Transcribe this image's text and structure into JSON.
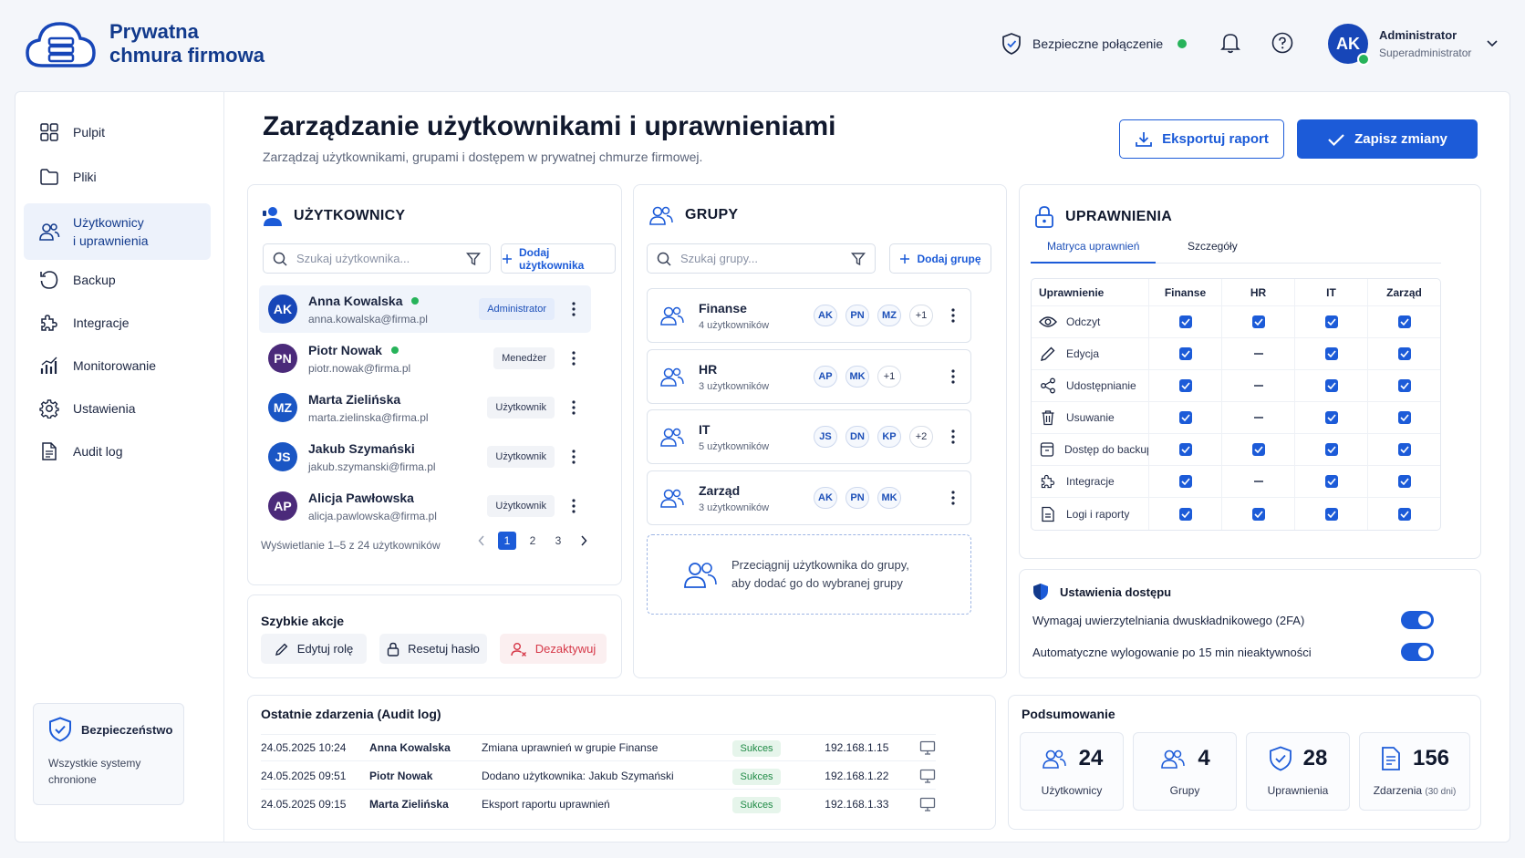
{
  "brand": {
    "line1": "Prywatna",
    "line2": "chmura firmowa"
  },
  "header": {
    "secure_label": "Bezpieczne połączenie",
    "user": {
      "initials": "AK",
      "name": "Administrator",
      "role": "Superadministrator"
    }
  },
  "sidebar": {
    "items": [
      {
        "label": "Pulpit",
        "icon": "grid-icon"
      },
      {
        "label": "Pliki",
        "icon": "folder-icon"
      },
      {
        "label": "Użytkownicy i uprawnienia",
        "line1": "Użytkownicy",
        "line2": "i uprawnienia",
        "icon": "users-icon",
        "active": true
      },
      {
        "label": "Backup",
        "icon": "backup-icon"
      },
      {
        "label": "Integracje",
        "icon": "puzzle-icon"
      },
      {
        "label": "Monitorowanie",
        "icon": "chart-icon"
      },
      {
        "label": "Ustawienia",
        "icon": "gear-icon"
      },
      {
        "label": "Audit log",
        "icon": "document-icon"
      }
    ],
    "security": {
      "title": "Bezpieczeństwo",
      "desc_line1": "Wszystkie systemy",
      "desc_line2": "chronione"
    }
  },
  "page": {
    "title": "Zarządzanie użytkownikami i uprawnieniami",
    "subtitle": "Zarządzaj użytkownikami, grupami i dostępem w prywatnej chmurze firmowej.",
    "export_label": "Eksportuj raport",
    "save_label": "Zapisz zmiany"
  },
  "users": {
    "title": "UŻYTKOWNICY",
    "search_placeholder": "Szukaj użytkownika...",
    "add_label": "Dodaj użytkownika",
    "list": [
      {
        "initials": "AK",
        "name": "Anna Kowalska",
        "email": "anna.kowalska@firma.pl",
        "role": "Administrator",
        "online": true,
        "color": "#1746b8"
      },
      {
        "initials": "PN",
        "name": "Piotr Nowak",
        "email": "piotr.nowak@firma.pl",
        "role": "Menedżer",
        "online": true,
        "color": "#4b2a7a"
      },
      {
        "initials": "MZ",
        "name": "Marta Zielińska",
        "email": "marta.zielinska@firma.pl",
        "role": "Użytkownik",
        "online": false,
        "color": "#1a56c4"
      },
      {
        "initials": "JS",
        "name": "Jakub Szymański",
        "email": "jakub.szymanski@firma.pl",
        "role": "Użytkownik",
        "online": false,
        "color": "#1a56c4"
      },
      {
        "initials": "AP",
        "name": "Alicja Pawłowska",
        "email": "alicja.pawlowska@firma.pl",
        "role": "Użytkownik",
        "online": false,
        "color": "#4b2a7a"
      }
    ],
    "pagination_text": "Wyświetlanie 1–5 z 24 użytkowników",
    "pages": [
      "1",
      "2",
      "3"
    ],
    "current_page": "1"
  },
  "quick_actions": {
    "title": "Szybkie akcje",
    "edit_role": "Edytuj rolę",
    "reset_password": "Resetuj hasło",
    "deactivate": "Dezaktywuj"
  },
  "groups": {
    "title": "GRUPY",
    "search_placeholder": "Szukaj grupy...",
    "add_label": "Dodaj grupę",
    "list": [
      {
        "name": "Finanse",
        "count": "4 użytkowników",
        "members": [
          "AK",
          "PN",
          "MZ"
        ],
        "more": "+1"
      },
      {
        "name": "HR",
        "count": "3 użytkowników",
        "members": [
          "AP",
          "MK"
        ],
        "more": "+1"
      },
      {
        "name": "IT",
        "count": "5 użytkowników",
        "members": [
          "JS",
          "DN",
          "KP"
        ],
        "more": "+2"
      },
      {
        "name": "Zarząd",
        "count": "3 użytkowników",
        "members": [
          "AK",
          "PN",
          "MK"
        ],
        "more": ""
      }
    ],
    "drop_line1": "Przeciągnij użytkownika do grupy,",
    "drop_line2": "aby dodać go do wybranej grupy"
  },
  "permissions": {
    "title": "UPRAWNIENIA",
    "tabs": [
      "Matryca uprawnień",
      "Szczegóły"
    ],
    "columns": [
      "Uprawnienie",
      "Finanse",
      "HR",
      "IT",
      "Zarząd"
    ],
    "rows": [
      {
        "label": "Odczyt",
        "icon": "eye-icon",
        "values": [
          true,
          true,
          true,
          true
        ]
      },
      {
        "label": "Edycja",
        "icon": "pencil-icon",
        "values": [
          true,
          false,
          true,
          true
        ]
      },
      {
        "label": "Udostępnianie",
        "icon": "share-icon",
        "values": [
          true,
          false,
          true,
          true
        ]
      },
      {
        "label": "Usuwanie",
        "icon": "trash-icon",
        "values": [
          true,
          false,
          true,
          true
        ]
      },
      {
        "label": "Dostęp do backupu",
        "icon": "archive-icon",
        "values": [
          true,
          true,
          true,
          true
        ]
      },
      {
        "label": "Integracje",
        "icon": "puzzle-icon",
        "values": [
          true,
          false,
          true,
          true
        ]
      },
      {
        "label": "Logi i raporty",
        "icon": "document-icon",
        "values": [
          true,
          true,
          true,
          true
        ]
      }
    ]
  },
  "access_settings": {
    "title": "Ustawienia dostępu",
    "twofa": "Wymagaj uwierzytelniania dwuskładnikowego (2FA)",
    "autologout": "Automatyczne wylogowanie po 15 min nieaktywności"
  },
  "audit": {
    "title": "Ostatnie zdarzenia (Audit log)",
    "rows": [
      {
        "time": "24.05.2025 10:24",
        "user": "Anna Kowalska",
        "action": "Zmiana uprawnień w grupie Finanse",
        "status": "Sukces",
        "ip": "192.168.1.15"
      },
      {
        "time": "24.05.2025 09:51",
        "user": "Piotr Nowak",
        "action": "Dodano użytkownika: Jakub Szymański",
        "status": "Sukces",
        "ip": "192.168.1.22"
      },
      {
        "time": "24.05.2025 09:15",
        "user": "Marta Zielińska",
        "action": "Eksport raportu uprawnień",
        "status": "Sukces",
        "ip": "192.168.1.33"
      }
    ]
  },
  "summary": {
    "title": "Podsumowanie",
    "users": {
      "value": "24",
      "label": "Użytkownicy"
    },
    "groups": {
      "value": "4",
      "label": "Grupy"
    },
    "permissions": {
      "value": "28",
      "label": "Uprawnienia"
    },
    "events": {
      "value": "156",
      "label": "Zdarzenia",
      "note": "(30 dni)"
    }
  },
  "colors": {
    "primary": "#1c5bd8",
    "brand": "#123a8c",
    "success": "#27b35a",
    "danger": "#d63848"
  }
}
